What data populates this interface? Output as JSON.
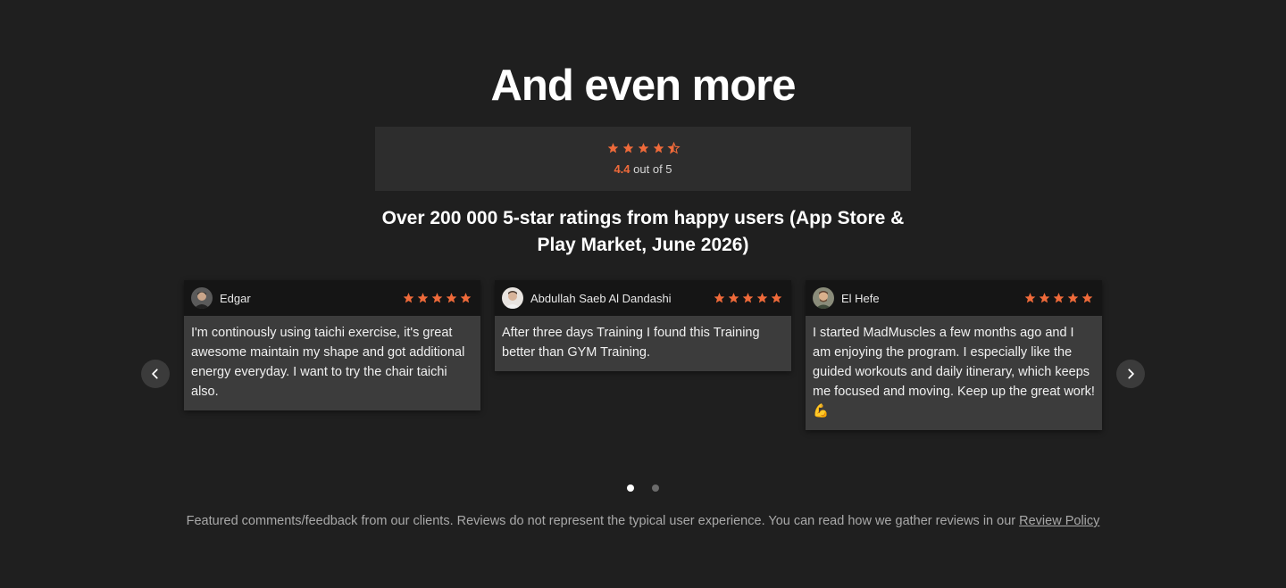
{
  "section": {
    "title": "And even more",
    "subtitle": "Over 200 000 5-star ratings from happy users (App Store & Play Market, June 2026)"
  },
  "rating": {
    "value": "4.4",
    "suffix": "out of 5",
    "stars": 4.5,
    "star_color": "#ef6a3a"
  },
  "carousel": {
    "prev_icon": "chevron-left-icon",
    "next_icon": "chevron-right-icon",
    "page_count": 2,
    "active_page": 1
  },
  "reviews": [
    {
      "name": "Edgar",
      "stars": 5,
      "text": "I'm continously using taichi exercise, it's great awesome maintain my shape and got additional energy everyday. I want to try the chair taichi also."
    },
    {
      "name": "Abdullah Saeb Al Dandashi",
      "stars": 5,
      "text": "After three days Training I found this Training better than GYM Training."
    },
    {
      "name": "El Hefe",
      "stars": 5,
      "text": "I started MadMuscles a few months ago and I am enjoying the program. I especially like the guided workouts and daily itinerary, which keeps me focused and moving. Keep up the great work! 💪"
    }
  ],
  "footer": {
    "disclaimer": "Featured comments/feedback from our clients. Reviews do not represent the typical user experience. You can read how we gather reviews in our",
    "link_label": "Review Policy"
  }
}
